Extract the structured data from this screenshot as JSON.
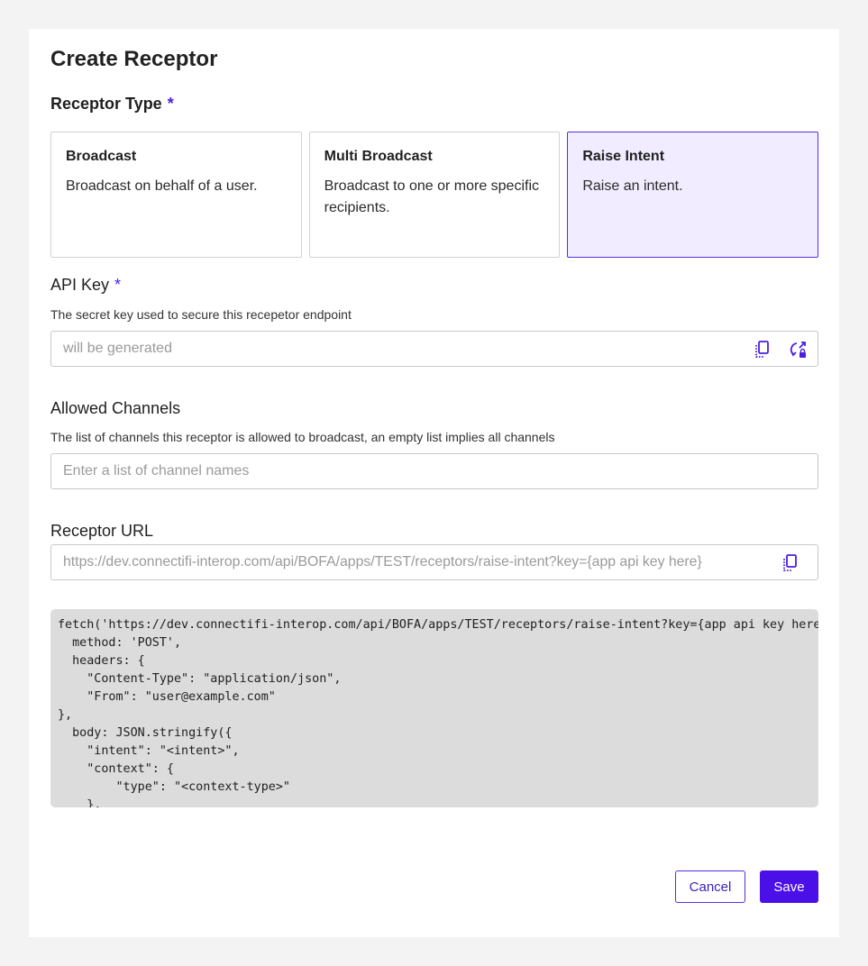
{
  "title": "Create Receptor",
  "receptor_type": {
    "label": "Receptor Type",
    "required_mark": "*",
    "options": [
      {
        "title": "Broadcast",
        "desc": "Broadcast on behalf of a user.",
        "selected": false
      },
      {
        "title": "Multi Broadcast",
        "desc": "Broadcast to one or more specific recipients.",
        "selected": false
      },
      {
        "title": "Raise Intent",
        "desc": "Raise an intent.",
        "selected": true
      }
    ]
  },
  "api_key": {
    "label": "API Key",
    "required_mark": "*",
    "hint": "The secret key used to secure this recepetor endpoint",
    "placeholder": "will be generated",
    "copy_icon": "copy-icon",
    "regenerate_icon": "regenerate-key-icon"
  },
  "allowed_channels": {
    "label": "Allowed Channels",
    "hint": "The list of channels this receptor is allowed to broadcast, an empty list implies all channels",
    "placeholder": "Enter a list of channel names"
  },
  "receptor_url": {
    "label": "Receptor URL",
    "value": "https://dev.connectifi-interop.com/api/BOFA/apps/TEST/receptors/raise-intent?key={app api key here}",
    "copy_icon": "copy-icon"
  },
  "code_sample": "fetch('https://dev.connectifi-interop.com/api/BOFA/apps/TEST/receptors/raise-intent?key={app api key here}', {\n  method: 'POST',\n  headers: {\n    \"Content-Type\": \"application/json\",\n    \"From\": \"user@example.com\"\n},\n  body: JSON.stringify({\n    \"intent\": \"<intent>\",\n    \"context\": {\n        \"type\": \"<context-type>\"\n    },\n  })\n})",
  "actions": {
    "cancel": "Cancel",
    "save": "Save"
  },
  "colors": {
    "accent": "#4b10e8",
    "selected_bg": "#f1ecff",
    "code_bg": "#dcdcdc"
  }
}
